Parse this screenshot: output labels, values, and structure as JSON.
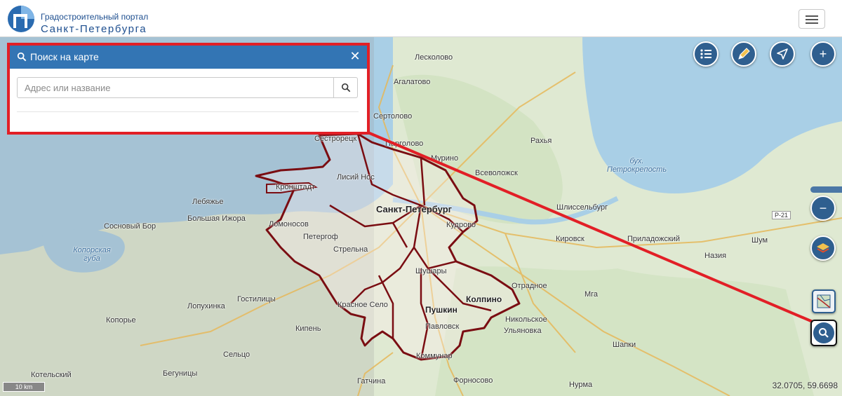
{
  "header": {
    "brand_line1": "Градостроительный портал",
    "brand_line2": "Санкт-Петербурга",
    "menu_icon": "hamburger-icon"
  },
  "search_panel": {
    "title": "Поиск на карте",
    "input_placeholder": "Адрес или название",
    "icons": [
      "search-icon",
      "close-icon"
    ]
  },
  "map": {
    "places": [
      {
        "name": "Лесколово",
        "type": "town"
      },
      {
        "name": "Агалатово",
        "type": "town"
      },
      {
        "name": "Сертолово",
        "type": "town"
      },
      {
        "name": "Сестрорецк",
        "type": "town"
      },
      {
        "name": "Парголово",
        "type": "town"
      },
      {
        "name": "Мурино",
        "type": "town"
      },
      {
        "name": "Рахья",
        "type": "town"
      },
      {
        "name": "Всеволожск",
        "type": "town"
      },
      {
        "name": "бух. Петрокрепость",
        "type": "water"
      },
      {
        "name": "Кронштадт",
        "type": "town"
      },
      {
        "name": "Лисий Нос",
        "type": "town"
      },
      {
        "name": "Лебяжье",
        "type": "town"
      },
      {
        "name": "Большая Ижора",
        "type": "town"
      },
      {
        "name": "Сосновый Бор",
        "type": "town"
      },
      {
        "name": "Санкт-Петербург",
        "type": "city"
      },
      {
        "name": "Шлиссельбург",
        "type": "town"
      },
      {
        "name": "Р-21",
        "type": "road"
      },
      {
        "name": "Ломоносов",
        "type": "town"
      },
      {
        "name": "Кудрово",
        "type": "town"
      },
      {
        "name": "Петергоф",
        "type": "town"
      },
      {
        "name": "Кировск",
        "type": "town"
      },
      {
        "name": "Приладожский",
        "type": "town"
      },
      {
        "name": "Шум",
        "type": "town"
      },
      {
        "name": "Копорская губа",
        "type": "water"
      },
      {
        "name": "Стрельна",
        "type": "town"
      },
      {
        "name": "Назия",
        "type": "town"
      },
      {
        "name": "Шушары",
        "type": "town"
      },
      {
        "name": "Отрадное",
        "type": "town"
      },
      {
        "name": "Лопухинка",
        "type": "town"
      },
      {
        "name": "Гостилицы",
        "type": "town"
      },
      {
        "name": "Красное Село",
        "type": "town"
      },
      {
        "name": "Мга",
        "type": "town"
      },
      {
        "name": "Пушкин",
        "type": "town"
      },
      {
        "name": "Колпино",
        "type": "town"
      },
      {
        "name": "Копорье",
        "type": "town"
      },
      {
        "name": "Никольское",
        "type": "town"
      },
      {
        "name": "Кипень",
        "type": "town"
      },
      {
        "name": "Павловск",
        "type": "town"
      },
      {
        "name": "Ульяновка",
        "type": "town"
      },
      {
        "name": "Сельцо",
        "type": "town"
      },
      {
        "name": "Коммунар",
        "type": "town"
      },
      {
        "name": "Шапки",
        "type": "town"
      },
      {
        "name": "Котельский",
        "type": "town"
      },
      {
        "name": "Бегуницы",
        "type": "town"
      },
      {
        "name": "Гатчина",
        "type": "town"
      },
      {
        "name": "Форносово",
        "type": "town"
      },
      {
        "name": "Нурма",
        "type": "town"
      }
    ],
    "scale_label": "10 km",
    "coordinates": "32.0705, 59.6698"
  },
  "controls": {
    "top": [
      "legend-list-icon",
      "draw-pencil-icon",
      "navigation-arrow-icon",
      "zoom-in-icon"
    ],
    "right": [
      "zoom-out-icon",
      "layers-icon",
      "map-region-icon",
      "search-icon"
    ],
    "zoom_in": "+",
    "zoom_out": "−"
  },
  "colors": {
    "accent": "#3375b4",
    "highlight_border": "#e21f26",
    "district_border": "#7a0d12",
    "control_bg": "#2f5f8f"
  }
}
